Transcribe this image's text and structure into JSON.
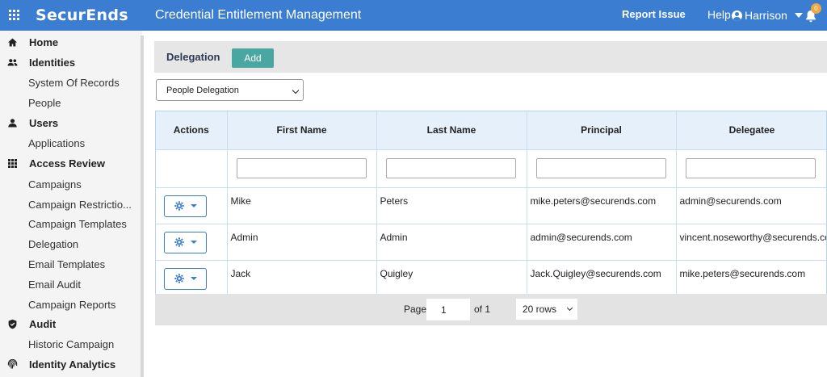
{
  "header": {
    "logo": "SecurEnds",
    "app_title": "Credential Entitlement Management",
    "report_issue": "Report Issue",
    "help": "Help",
    "user_name": "Harrison",
    "notification_count": "0"
  },
  "sidebar": {
    "items": [
      {
        "label": "Home",
        "type": "section",
        "icon": "home-icon"
      },
      {
        "label": "Identities",
        "type": "section",
        "icon": "people-icon"
      },
      {
        "label": "System Of Records",
        "type": "sub"
      },
      {
        "label": "People",
        "type": "sub"
      },
      {
        "label": "Users",
        "type": "section",
        "icon": "user-icon"
      },
      {
        "label": "Applications",
        "type": "sub"
      },
      {
        "label": "Access Review",
        "type": "section",
        "icon": "grid-icon"
      },
      {
        "label": "Campaigns",
        "type": "sub"
      },
      {
        "label": "Campaign Restrictio...",
        "type": "sub"
      },
      {
        "label": "Campaign Templates",
        "type": "sub"
      },
      {
        "label": "Delegation",
        "type": "sub"
      },
      {
        "label": "Email Templates",
        "type": "sub"
      },
      {
        "label": "Email Audit",
        "type": "sub"
      },
      {
        "label": "Campaign Reports",
        "type": "sub"
      },
      {
        "label": "Audit",
        "type": "section",
        "icon": "shield-icon"
      },
      {
        "label": "Historic Campaign",
        "type": "sub"
      },
      {
        "label": "Identity Analytics",
        "type": "section",
        "icon": "fingerprint-icon"
      }
    ]
  },
  "page": {
    "title": "Delegation",
    "add_label": "Add",
    "delegation_type": "People Delegation"
  },
  "table": {
    "columns": [
      "Actions",
      "First Name",
      "Last Name",
      "Principal",
      "Delegatee"
    ],
    "rows": [
      {
        "first_name": "Mike",
        "last_name": "Peters",
        "principal": "mike.peters@securends.com",
        "delegatee": "admin@securends.com"
      },
      {
        "first_name": "Admin",
        "last_name": "Admin",
        "principal": "admin@securends.com",
        "delegatee": "vincent.noseworthy@securends.com"
      },
      {
        "first_name": "Jack",
        "last_name": "Quigley",
        "principal": "Jack.Quigley@securends.com",
        "delegatee": "mike.peters@securends.com"
      }
    ]
  },
  "pagination": {
    "page_label": "Page",
    "current_page": "1",
    "of_label": "of 1",
    "rows_option": "20 rows"
  },
  "colors": {
    "topbar": "#3a7dd1",
    "add_button": "#4aa6a0",
    "table_header": "#e6f0fb",
    "badge": "#f0a63d"
  }
}
